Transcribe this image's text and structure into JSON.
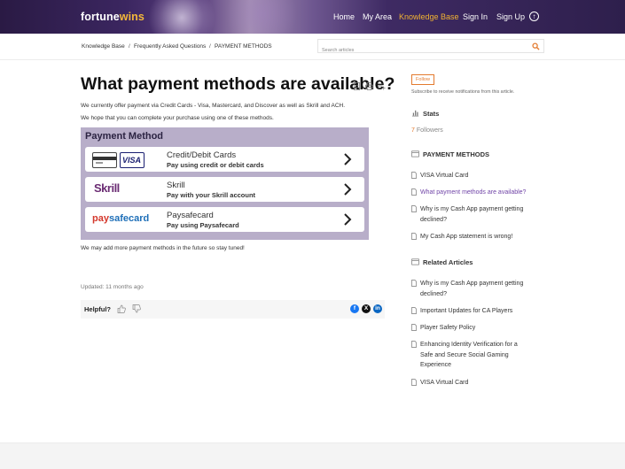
{
  "header": {
    "logo_fortune": "fortune",
    "logo_wins": "wins",
    "nav": [
      "Home",
      "My Area",
      "Knowledge Base",
      "Sign In",
      "Sign Up"
    ],
    "active_nav": "Knowledge Base",
    "accent_color": "#f0b232"
  },
  "breadcrumb": [
    "Knowledge Base",
    "Frequently Asked Questions",
    "PAYMENT METHODS"
  ],
  "search": {
    "placeholder": "Search articles",
    "value": ""
  },
  "article": {
    "title": "What payment methods are available?",
    "para1": "We currently offer payment via Credit Cards - Visa, Mastercard, and Discover as well as Skrill and ACH.",
    "para2": "We hope that you can complete your purchase using one of these methods.",
    "payment_image": {
      "heading": "Payment Method",
      "methods": [
        {
          "name": "Credit/Debit Cards",
          "sub": "Pay using credit or debit cards",
          "logo": "VISA"
        },
        {
          "name": "Skrill",
          "sub": "Pay with your Skrill account",
          "logo": "Skrill"
        },
        {
          "name": "Paysafecard",
          "sub": "Pay using Paysafecard",
          "logo_pay": "pay",
          "logo_rest": "safecard"
        }
      ]
    },
    "para3": "We may add more payment methods in the future so stay tuned!",
    "updated": "Updated: 11 months ago",
    "helpful": "Helpful?"
  },
  "sidebar": {
    "follow_label": "Follow",
    "follow_note": "Subscribe to receive notifications from this article.",
    "stats_heading": "Stats",
    "followers_count": "7",
    "followers_label": " Followers",
    "category_heading": "PAYMENT METHODS",
    "category_links": [
      "VISA Virtual Card",
      "What payment methods are available?",
      "Why is my Cash App payment getting declined?",
      "My Cash App statement is wrong!"
    ],
    "related_heading": "Related Articles",
    "related_links": [
      "Why is my Cash App payment getting declined?",
      "Important Updates for CA Players",
      "Player Safety Policy",
      "Enhancing Identity Verification for a Safe and Secure Social Gaming Experience",
      "VISA Virtual Card"
    ],
    "current_link_color": "#7044a7"
  },
  "colors": {
    "orange": "#e37a2e",
    "purple_panel": "#b8aec9"
  }
}
